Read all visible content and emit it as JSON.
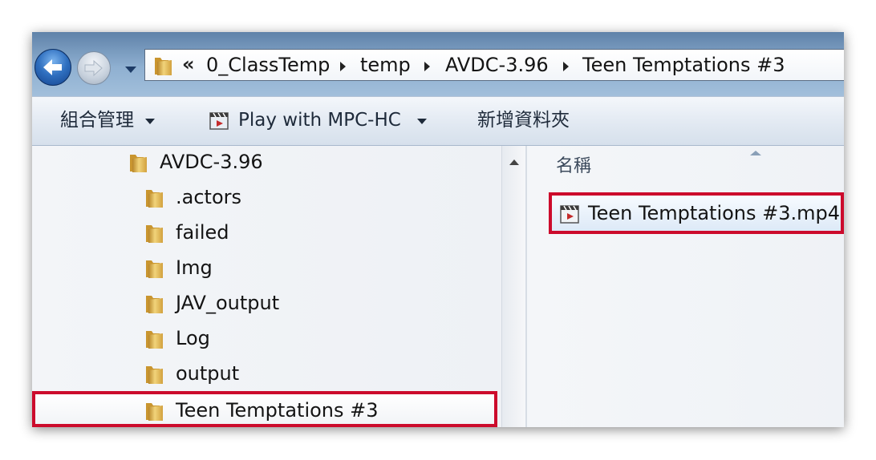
{
  "address_bar": {
    "overflow": "«",
    "breadcrumbs": [
      "0_ClassTemp",
      "temp",
      "AVDC-3.96",
      "Teen Temptations #3"
    ]
  },
  "command_bar": {
    "organize": "組合管理",
    "play_with": "Play with MPC-HC",
    "new_folder": "新增資料夾"
  },
  "nav_tree": {
    "parent": "AVDC-3.96",
    "children": [
      ".actors",
      "failed",
      "Img",
      "JAV_output",
      "Log",
      "output",
      "Teen Temptations #3"
    ],
    "selected": "Teen Temptations #3"
  },
  "content": {
    "column_header": "名稱",
    "files": [
      "Teen Temptations #3.mp4"
    ]
  },
  "colors": {
    "highlight_border": "#cc0b2c",
    "address_bar": "#8fb0d1",
    "folder": "#e2b84a"
  },
  "icons": {
    "back": "back-arrow-icon",
    "forward": "forward-arrow-icon",
    "folder": "folder-icon",
    "video_file": "video-file-icon"
  }
}
